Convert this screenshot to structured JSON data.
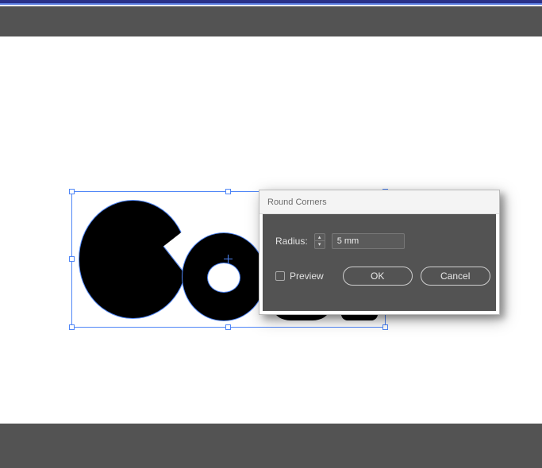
{
  "dialog": {
    "title": "Round Corners",
    "radius_label": "Radius:",
    "radius_value": "5 mm",
    "preview_label": "Preview",
    "preview_checked": false,
    "ok_label": "OK",
    "cancel_label": "Cancel"
  },
  "artwork": {
    "visible_text": "Co",
    "selection": {
      "handles": 8
    }
  }
}
